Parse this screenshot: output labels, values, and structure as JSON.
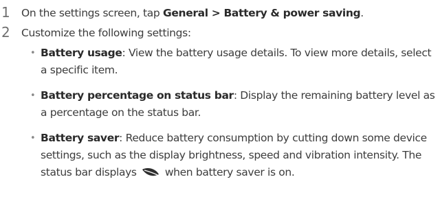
{
  "step1": {
    "number": "1",
    "prefix": "On the settings screen, tap ",
    "path_a": "General",
    "sep": " > ",
    "path_b": "Battery & power saving",
    "suffix": "."
  },
  "step2": {
    "number": "2",
    "text": "Customize the following settings:"
  },
  "bullets": [
    {
      "term": "Battery usage",
      "desc": ": View the battery usage details. To view more details, select a specific item."
    },
    {
      "term": "Battery percentage on status bar",
      "desc": ": Display the remaining battery level as a percentage on the status bar."
    },
    {
      "term": "Battery saver",
      "desc_before": ": Reduce battery consumption by cutting down some device settings, such as the display brightness, speed and vibration intensity. The status bar displays",
      "icon": "battery-saver-leaf-icon",
      "desc_after": "when battery saver is on."
    }
  ]
}
